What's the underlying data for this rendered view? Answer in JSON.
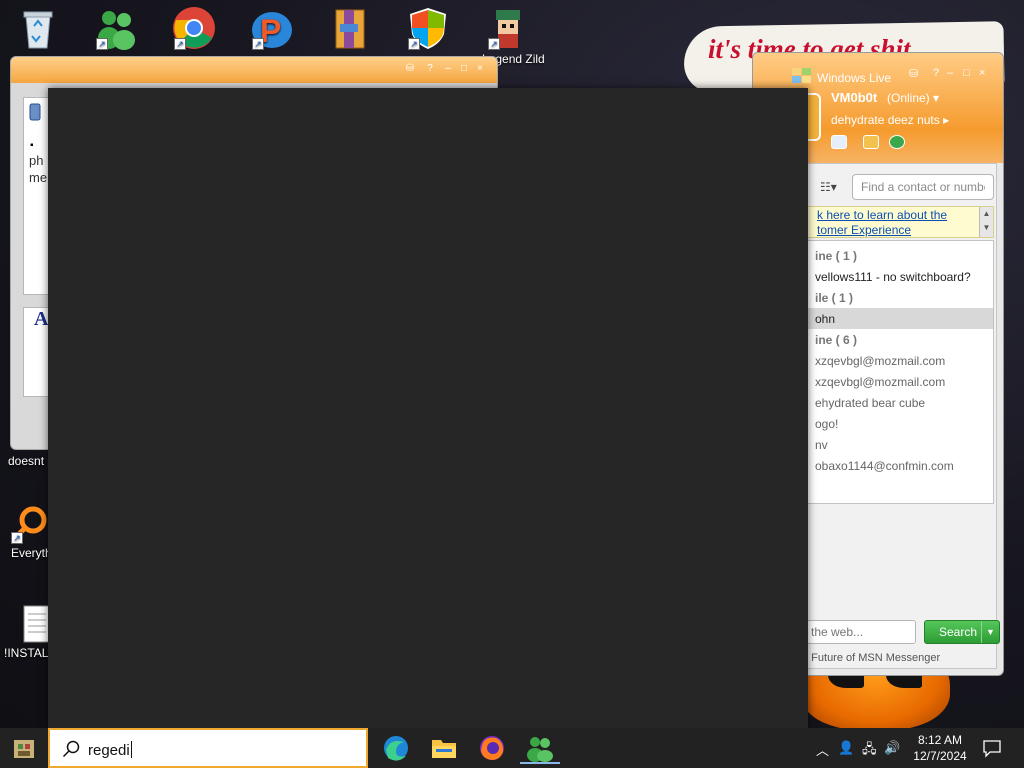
{
  "desktop": {
    "wallpaper_text": "it's time to get shit",
    "icons": [
      {
        "name": "recycle-bin",
        "label": ""
      },
      {
        "name": "msn-messenger",
        "label": ""
      },
      {
        "name": "chrome",
        "label": ""
      },
      {
        "name": "paint-app",
        "label": ""
      },
      {
        "name": "winrar-archive",
        "label": ""
      },
      {
        "name": "windows-security",
        "label": ""
      },
      {
        "name": "legend-zilda",
        "label": "Legend Zilda"
      },
      {
        "name": "doesnt-file",
        "label": "doesnt"
      },
      {
        "name": "everything-search",
        "label": "Everyth"
      },
      {
        "name": "install-file",
        "label": "!INSTALL"
      }
    ]
  },
  "left_window": {
    "panel_lines": [
      "ph",
      "me"
    ],
    "panel_letter": "A"
  },
  "wlm": {
    "title": "Windows Live",
    "username": "VM0b0t",
    "status": "(Online)",
    "personal_message": "dehydrate deez nuts",
    "find_placeholder": "Find a contact or number",
    "ad_text": "k here to learn about the tomer Experience",
    "contacts": [
      {
        "label": "ine ( 1 )",
        "kind": "group"
      },
      {
        "label": "vellows111 - no switchboard?",
        "kind": "online"
      },
      {
        "label": "ile ( 1 )",
        "kind": "group"
      },
      {
        "label": "ohn",
        "kind": "selected"
      },
      {
        "label": "ine ( 6 )",
        "kind": "group"
      },
      {
        "label": "xzqevbgl@mozmail.com",
        "kind": "offline"
      },
      {
        "label": "xzqevbgl@mozmail.com",
        "kind": "offline"
      },
      {
        "label": "ehydrated bear cube",
        "kind": "offline"
      },
      {
        "label": "ogo!",
        "kind": "offline"
      },
      {
        "label": "nv",
        "kind": "offline"
      },
      {
        "label": "obaxo1144@confmin.com",
        "kind": "offline"
      }
    ],
    "search_web_placeholder": "the web...",
    "search_button": "Search",
    "footer": "e Future of MSN Messenger"
  },
  "taskbar": {
    "search_value": "regedi",
    "apps": [
      "edge",
      "file-explorer",
      "firefox",
      "msn-messenger"
    ],
    "clock_time": "8:12 AM",
    "clock_date": "12/7/2024"
  },
  "colors": {
    "taskbar": "#222222",
    "overlay": "#262626",
    "messenger_orange": "#f59b2e",
    "search_green": "#2c9c34",
    "search_border": "#f0a830"
  }
}
